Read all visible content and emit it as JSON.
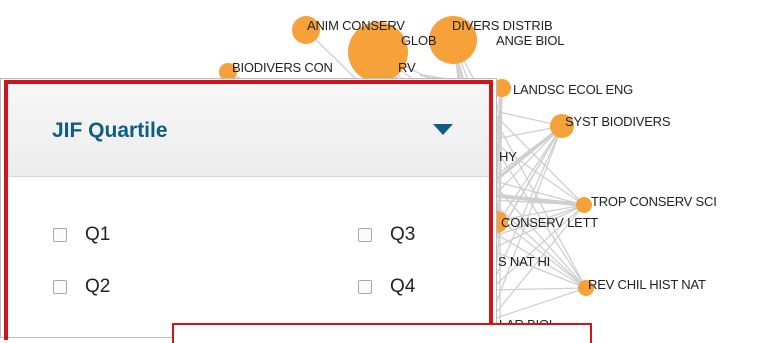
{
  "network": {
    "node_color": "#f7a13b",
    "edge_color": "#cfcfcf",
    "labels": {
      "anim_conserv": "ANIM CONSERV",
      "glob": "GLOB",
      "divers_distrib": "DIVERS DISTRIB",
      "ange_biol": "ANGE BIOL",
      "biodivers_con": "BIODIVERS CON",
      "rv": "RV",
      "landsc_ecol_eng": "LANDSC ECOL ENG",
      "syst_biodivers": "SYST BIODIVERS",
      "hy": "HY",
      "trop_conserv_sci": "TROP CONSERV SCI",
      "conserv_lett": "CONSERV LETT",
      "s_nat_hi": "S NAT HI",
      "rev_chil_hist_nat": "REV CHIL HIST NAT",
      "lar_biol": "LAR BIOL"
    }
  },
  "filter": {
    "title": "JIF Quartile",
    "accent_color": "#0f5e82",
    "highlight_color": "#d0141b",
    "options": [
      {
        "label": "Q1",
        "checked": false
      },
      {
        "label": "Q2",
        "checked": false
      },
      {
        "label": "Q3",
        "checked": false
      },
      {
        "label": "Q4",
        "checked": false
      }
    ]
  }
}
